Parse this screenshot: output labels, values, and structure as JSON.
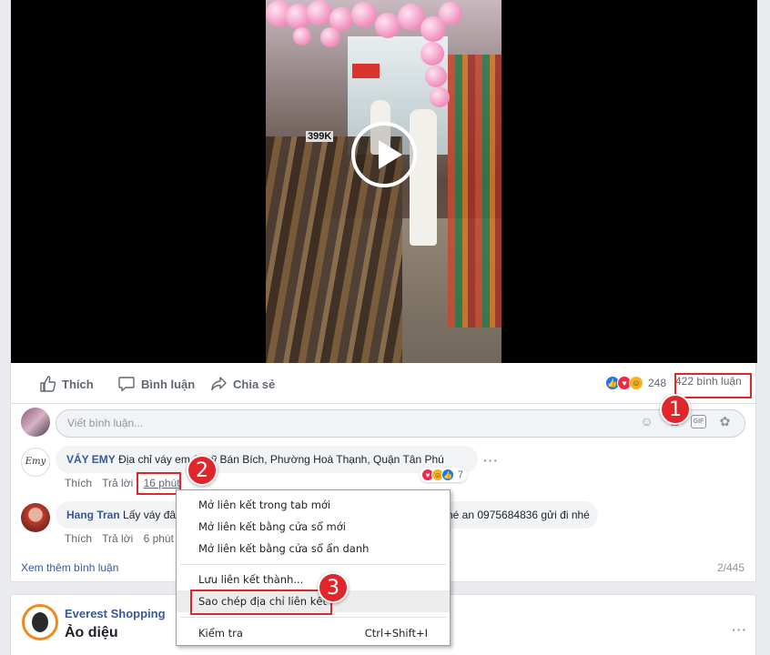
{
  "actions": {
    "like": "Thích",
    "comment": "Bình luận",
    "share": "Chia sẻ"
  },
  "reactions": {
    "count": "248",
    "comments": "422 bình luận"
  },
  "video": {
    "price_tag": "399K"
  },
  "composer": {
    "placeholder": "Viết bình luận...",
    "gif_label": "GIF"
  },
  "comments": [
    {
      "author": "VÁY EMY",
      "text": "Địa chỉ váy em",
      "text_after": "/ Luỹ Bán Bích, Phường Hoà Thạnh, Quận Tân Phú",
      "reply": "Trả lời",
      "like": "Thích",
      "time": "16 phút",
      "reaction_count": "7",
      "avatar_text": "Emy"
    },
    {
      "author": "Hang Tran",
      "text": "Lấy váy đâu",
      "text_after": "hé an 0975684836 gửi đi nhé",
      "reply": "Trả lời",
      "like": "Thích",
      "time": "6 phút"
    }
  ],
  "footer": {
    "more_comments": "Xem thêm bình luận",
    "count": "2/445"
  },
  "next_post": {
    "page_name": "Everest Shopping",
    "title": "Ảo diệu"
  },
  "context_menu": {
    "items": [
      {
        "label": "Mở liên kết trong tab mới"
      },
      {
        "label": "Mở liên kết bằng cửa sổ mới"
      },
      {
        "label": "Mở liên kết bằng cửa sổ ẩn danh"
      },
      {
        "label": "Lưu liên kết thành..."
      },
      {
        "label": "Sao chép địa chỉ liên kết"
      },
      {
        "label": "Kiểm tra",
        "shortcut": "Ctrl+Shift+I"
      }
    ]
  },
  "markers": [
    "1",
    "2",
    "3"
  ],
  "colors": {
    "accent": "#385898",
    "highlight": "#e0262b",
    "like": "#1877f2",
    "love": "#f0284a",
    "haha": "#f7b125"
  }
}
